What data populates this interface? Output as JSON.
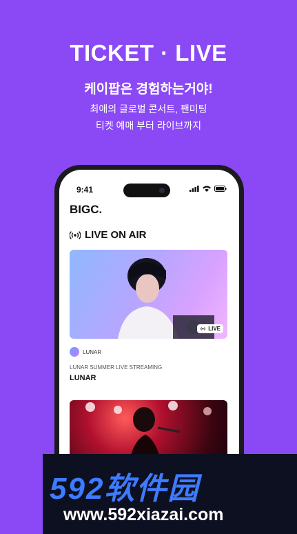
{
  "hero": {
    "title": "TICKET · LIVE",
    "subtitle": "케이팝은 경험하는거야!",
    "desc_line1": "최애의 글로벌 콘서트, 팬미팅",
    "desc_line2": "티켓 예매 부터 라이브까지"
  },
  "status_bar": {
    "time": "9:41"
  },
  "app": {
    "logo": "BIGC.",
    "section_title": "LIVE ON AIR",
    "cards": [
      {
        "badge": "LIVE",
        "artist": "LUNAR",
        "stream_title": "LUNAR SUMMER LIVE STREAMING",
        "name": "LUNAR"
      }
    ]
  },
  "watermark": {
    "brand": "592软件园",
    "url": "www.592xiazai.com"
  },
  "colors": {
    "background": "#8a49f5",
    "phone_frame": "#1b1b1f",
    "watermark_blue": "#3d7bff"
  }
}
